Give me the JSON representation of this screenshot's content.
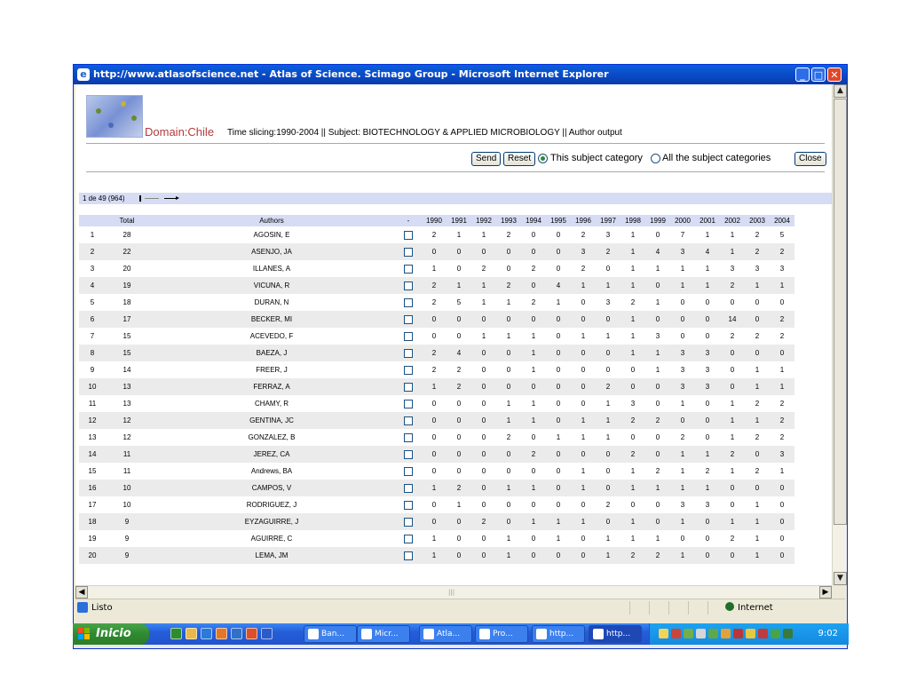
{
  "window": {
    "title": "http://www.atlasofscience.net - Atlas of Science. Scimago Group - Microsoft Internet Explorer"
  },
  "header": {
    "domain_label": "Domain:",
    "domain_value": "Chile",
    "meta": "Time slicing:1990-2004 || Subject: BIOTECHNOLOGY & APPLIED MICROBIOLOGY || Author output"
  },
  "controls": {
    "send": "Send",
    "reset": "Reset",
    "radio_this": "This subject category",
    "radio_all": "All the subject categories",
    "selected": "this",
    "close": "Close"
  },
  "pager": {
    "text": "1 de 49 (964)"
  },
  "table": {
    "headers": [
      "",
      "Total",
      "Authors",
      "-",
      "1990",
      "1991",
      "1992",
      "1993",
      "1994",
      "1995",
      "1996",
      "1997",
      "1998",
      "1999",
      "2000",
      "2001",
      "2002",
      "2003",
      "2004"
    ],
    "rows": [
      {
        "n": "1",
        "total": "28",
        "author": "AGOSIN, E",
        "years": [
          "2",
          "1",
          "1",
          "2",
          "0",
          "0",
          "2",
          "3",
          "1",
          "0",
          "7",
          "1",
          "1",
          "2",
          "5"
        ]
      },
      {
        "n": "2",
        "total": "22",
        "author": "ASENJO, JA",
        "years": [
          "0",
          "0",
          "0",
          "0",
          "0",
          "0",
          "3",
          "2",
          "1",
          "4",
          "3",
          "4",
          "1",
          "2",
          "2"
        ]
      },
      {
        "n": "3",
        "total": "20",
        "author": "ILLANES, A",
        "years": [
          "1",
          "0",
          "2",
          "0",
          "2",
          "0",
          "2",
          "0",
          "1",
          "1",
          "1",
          "1",
          "3",
          "3",
          "3"
        ]
      },
      {
        "n": "4",
        "total": "19",
        "author": "VICUNA, R",
        "years": [
          "2",
          "1",
          "1",
          "2",
          "0",
          "4",
          "1",
          "1",
          "1",
          "0",
          "1",
          "1",
          "2",
          "1",
          "1"
        ]
      },
      {
        "n": "5",
        "total": "18",
        "author": "DURAN, N",
        "years": [
          "2",
          "5",
          "1",
          "1",
          "2",
          "1",
          "0",
          "3",
          "2",
          "1",
          "0",
          "0",
          "0",
          "0",
          "0"
        ]
      },
      {
        "n": "6",
        "total": "17",
        "author": "BECKER, MI",
        "years": [
          "0",
          "0",
          "0",
          "0",
          "0",
          "0",
          "0",
          "0",
          "1",
          "0",
          "0",
          "0",
          "14",
          "0",
          "2"
        ]
      },
      {
        "n": "7",
        "total": "15",
        "author": "ACEVEDO, F",
        "years": [
          "0",
          "0",
          "1",
          "1",
          "1",
          "0",
          "1",
          "1",
          "1",
          "3",
          "0",
          "0",
          "2",
          "2",
          "2"
        ]
      },
      {
        "n": "8",
        "total": "15",
        "author": "BAEZA, J",
        "years": [
          "2",
          "4",
          "0",
          "0",
          "1",
          "0",
          "0",
          "0",
          "1",
          "1",
          "3",
          "3",
          "0",
          "0",
          "0"
        ]
      },
      {
        "n": "9",
        "total": "14",
        "author": "FREER, J",
        "years": [
          "2",
          "2",
          "0",
          "0",
          "1",
          "0",
          "0",
          "0",
          "0",
          "1",
          "3",
          "3",
          "0",
          "1",
          "1"
        ]
      },
      {
        "n": "10",
        "total": "13",
        "author": "FERRAZ, A",
        "years": [
          "1",
          "2",
          "0",
          "0",
          "0",
          "0",
          "0",
          "2",
          "0",
          "0",
          "3",
          "3",
          "0",
          "1",
          "1"
        ]
      },
      {
        "n": "11",
        "total": "13",
        "author": "CHAMY, R",
        "years": [
          "0",
          "0",
          "0",
          "1",
          "1",
          "0",
          "0",
          "1",
          "3",
          "0",
          "1",
          "0",
          "1",
          "2",
          "2"
        ]
      },
      {
        "n": "12",
        "total": "12",
        "author": "GENTINA, JC",
        "years": [
          "0",
          "0",
          "0",
          "1",
          "1",
          "0",
          "1",
          "1",
          "2",
          "2",
          "0",
          "0",
          "1",
          "1",
          "2"
        ]
      },
      {
        "n": "13",
        "total": "12",
        "author": "GONZALEZ, B",
        "years": [
          "0",
          "0",
          "0",
          "2",
          "0",
          "1",
          "1",
          "1",
          "0",
          "0",
          "2",
          "0",
          "1",
          "2",
          "2"
        ]
      },
      {
        "n": "14",
        "total": "11",
        "author": "JEREZ, CA",
        "years": [
          "0",
          "0",
          "0",
          "0",
          "2",
          "0",
          "0",
          "0",
          "2",
          "0",
          "1",
          "1",
          "2",
          "0",
          "3"
        ]
      },
      {
        "n": "15",
        "total": "11",
        "author": "Andrews, BA",
        "years": [
          "0",
          "0",
          "0",
          "0",
          "0",
          "0",
          "1",
          "0",
          "1",
          "2",
          "1",
          "2",
          "1",
          "2",
          "1"
        ]
      },
      {
        "n": "16",
        "total": "10",
        "author": "CAMPOS, V",
        "years": [
          "1",
          "2",
          "0",
          "1",
          "1",
          "0",
          "1",
          "0",
          "1",
          "1",
          "1",
          "1",
          "0",
          "0",
          "0"
        ]
      },
      {
        "n": "17",
        "total": "10",
        "author": "RODRIGUEZ, J",
        "years": [
          "0",
          "1",
          "0",
          "0",
          "0",
          "0",
          "0",
          "2",
          "0",
          "0",
          "3",
          "3",
          "0",
          "1",
          "0"
        ]
      },
      {
        "n": "18",
        "total": "9",
        "author": "EYZAGUIRRE, J",
        "years": [
          "0",
          "0",
          "2",
          "0",
          "1",
          "1",
          "1",
          "0",
          "1",
          "0",
          "1",
          "0",
          "1",
          "1",
          "0"
        ]
      },
      {
        "n": "19",
        "total": "9",
        "author": "AGUIRRE, C",
        "years": [
          "1",
          "0",
          "0",
          "1",
          "0",
          "1",
          "0",
          "1",
          "1",
          "1",
          "0",
          "0",
          "2",
          "1",
          "0"
        ]
      },
      {
        "n": "20",
        "total": "9",
        "author": "LEMA, JM",
        "years": [
          "1",
          "0",
          "0",
          "1",
          "0",
          "0",
          "0",
          "1",
          "2",
          "2",
          "1",
          "0",
          "0",
          "1",
          "0"
        ]
      }
    ]
  },
  "statusbar": {
    "text": "Listo",
    "zone": "Internet"
  },
  "taskbar": {
    "start": "Inicio",
    "tasks": [
      {
        "label": "Ban...",
        "active": false
      },
      {
        "label": "Micr...",
        "active": false
      },
      {
        "label": "Atla...",
        "active": false
      },
      {
        "label": "Pro...",
        "active": false
      },
      {
        "label": "http...",
        "active": false
      },
      {
        "label": "http...",
        "active": true
      }
    ],
    "clock": "9:02"
  }
}
